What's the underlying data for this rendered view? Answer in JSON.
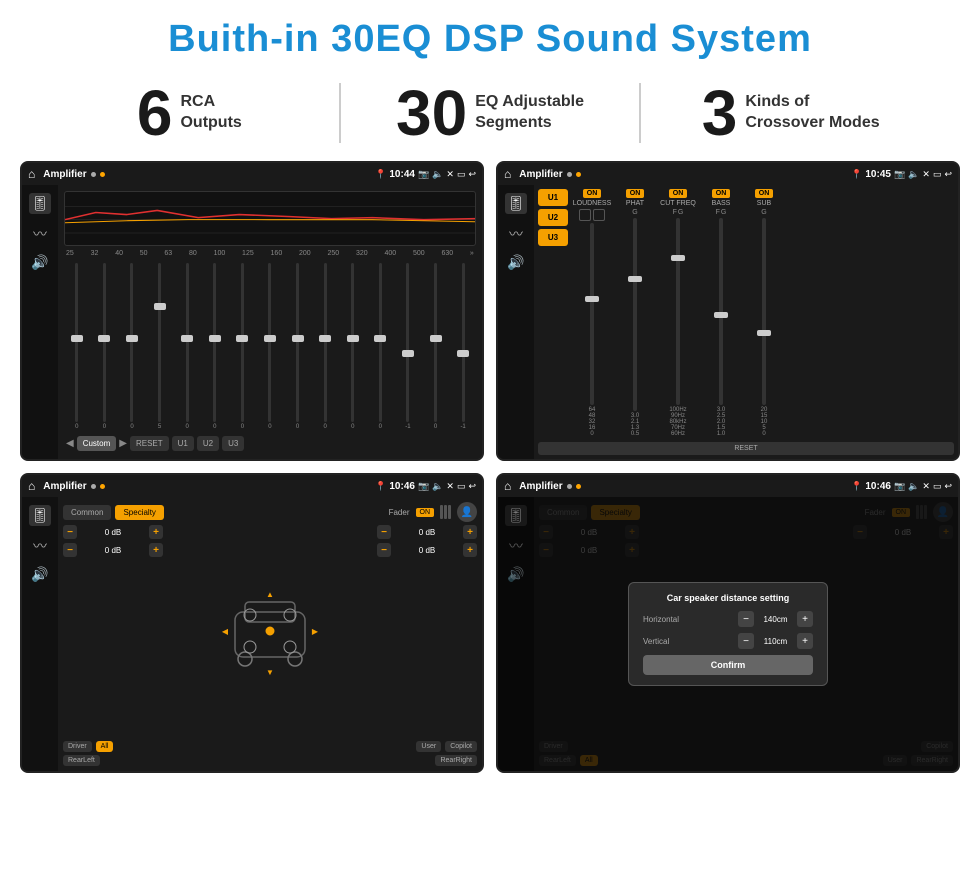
{
  "page": {
    "title": "Buith-in 30EQ DSP Sound System"
  },
  "stats": [
    {
      "number": "6",
      "label_line1": "RCA",
      "label_line2": "Outputs"
    },
    {
      "number": "30",
      "label_line1": "EQ Adjustable",
      "label_line2": "Segments"
    },
    {
      "number": "3",
      "label_line1": "Kinds of",
      "label_line2": "Crossover Modes"
    }
  ],
  "screens": {
    "screen1": {
      "title": "Amplifier",
      "time": "10:44",
      "eq_labels": [
        "25",
        "32",
        "40",
        "50",
        "63",
        "80",
        "100",
        "125",
        "160",
        "200",
        "250",
        "320",
        "400",
        "500",
        "630"
      ],
      "eq_values": [
        "0",
        "0",
        "0",
        "5",
        "0",
        "0",
        "0",
        "0",
        "0",
        "0",
        "0",
        "0",
        "-1",
        "0",
        "-1"
      ],
      "buttons": [
        "Custom",
        "RESET",
        "U1",
        "U2",
        "U3"
      ]
    },
    "screen2": {
      "title": "Amplifier",
      "time": "10:45",
      "presets": [
        "U1",
        "U2",
        "U3"
      ],
      "controls": [
        "LOUDNESS",
        "PHAT",
        "CUT FREQ",
        "BASS",
        "SUB"
      ],
      "reset_label": "RESET"
    },
    "screen3": {
      "title": "Amplifier",
      "time": "10:46",
      "tabs": [
        "Common",
        "Specialty"
      ],
      "active_tab": "Specialty",
      "fader_label": "Fader",
      "fader_on": "ON",
      "db_values": [
        "0 dB",
        "0 dB",
        "0 dB",
        "0 dB"
      ],
      "bottom_labels": [
        "Driver",
        "All",
        "User",
        "RearLeft",
        "Copilot",
        "RearRight"
      ]
    },
    "screen4": {
      "title": "Amplifier",
      "time": "10:46",
      "tabs": [
        "Common",
        "Specialty"
      ],
      "dialog": {
        "title": "Car speaker distance setting",
        "horizontal_label": "Horizontal",
        "horizontal_value": "140cm",
        "vertical_label": "Vertical",
        "vertical_value": "110cm",
        "confirm_label": "Confirm"
      },
      "db_labels": [
        "0 dB",
        "0 dB"
      ],
      "bottom_labels": [
        "Driver",
        "RearLeft",
        "All",
        "User",
        "Copilot",
        "RearRight"
      ]
    }
  }
}
